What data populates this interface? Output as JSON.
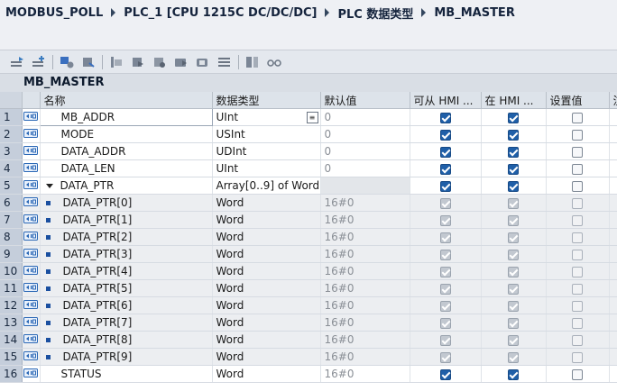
{
  "breadcrumb": [
    "MODBUS_POLL",
    "PLC_1 [CPU 1215C DC/DC/DC]",
    "PLC 数据类型",
    "MB_MASTER"
  ],
  "block_title": "MB_MASTER",
  "columns": [
    "名称",
    "数据类型",
    "默认值",
    "可从 HMI ...",
    "在 HMI ...",
    "设置值",
    "注"
  ],
  "rows": [
    {
      "num": "1",
      "name": "MB_ADDR",
      "type": "UInt",
      "default": "0",
      "hmi_access": true,
      "hmi_visible": true,
      "setpoint": false,
      "kind": "top",
      "selected": true
    },
    {
      "num": "2",
      "name": "MODE",
      "type": "USInt",
      "default": "0",
      "hmi_access": true,
      "hmi_visible": true,
      "setpoint": false,
      "kind": "top"
    },
    {
      "num": "3",
      "name": "DATA_ADDR",
      "type": "UDInt",
      "default": "0",
      "hmi_access": true,
      "hmi_visible": true,
      "setpoint": false,
      "kind": "top"
    },
    {
      "num": "4",
      "name": "DATA_LEN",
      "type": "UInt",
      "default": "0",
      "hmi_access": true,
      "hmi_visible": true,
      "setpoint": false,
      "kind": "top"
    },
    {
      "num": "5",
      "name": "DATA_PTR",
      "type": "Array[0..9] of Word",
      "default": "",
      "hmi_access": true,
      "hmi_visible": true,
      "setpoint": false,
      "kind": "array"
    },
    {
      "num": "6",
      "name": "DATA_PTR[0]",
      "type": "Word",
      "default": "16#0",
      "hmi_access": true,
      "hmi_visible": true,
      "setpoint": false,
      "kind": "child"
    },
    {
      "num": "7",
      "name": "DATA_PTR[1]",
      "type": "Word",
      "default": "16#0",
      "hmi_access": true,
      "hmi_visible": true,
      "setpoint": false,
      "kind": "child"
    },
    {
      "num": "8",
      "name": "DATA_PTR[2]",
      "type": "Word",
      "default": "16#0",
      "hmi_access": true,
      "hmi_visible": true,
      "setpoint": false,
      "kind": "child"
    },
    {
      "num": "9",
      "name": "DATA_PTR[3]",
      "type": "Word",
      "default": "16#0",
      "hmi_access": true,
      "hmi_visible": true,
      "setpoint": false,
      "kind": "child"
    },
    {
      "num": "10",
      "name": "DATA_PTR[4]",
      "type": "Word",
      "default": "16#0",
      "hmi_access": true,
      "hmi_visible": true,
      "setpoint": false,
      "kind": "child"
    },
    {
      "num": "11",
      "name": "DATA_PTR[5]",
      "type": "Word",
      "default": "16#0",
      "hmi_access": true,
      "hmi_visible": true,
      "setpoint": false,
      "kind": "child"
    },
    {
      "num": "12",
      "name": "DATA_PTR[6]",
      "type": "Word",
      "default": "16#0",
      "hmi_access": true,
      "hmi_visible": true,
      "setpoint": false,
      "kind": "child"
    },
    {
      "num": "13",
      "name": "DATA_PTR[7]",
      "type": "Word",
      "default": "16#0",
      "hmi_access": true,
      "hmi_visible": true,
      "setpoint": false,
      "kind": "child"
    },
    {
      "num": "14",
      "name": "DATA_PTR[8]",
      "type": "Word",
      "default": "16#0",
      "hmi_access": true,
      "hmi_visible": true,
      "setpoint": false,
      "kind": "child"
    },
    {
      "num": "15",
      "name": "DATA_PTR[9]",
      "type": "Word",
      "default": "16#0",
      "hmi_access": true,
      "hmi_visible": true,
      "setpoint": false,
      "kind": "child"
    },
    {
      "num": "16",
      "name": "STATUS",
      "type": "Word",
      "default": "16#0",
      "hmi_access": true,
      "hmi_visible": true,
      "setpoint": false,
      "kind": "top"
    }
  ],
  "toolbar": {
    "icons": [
      "insert-row-icon",
      "add-row-icon",
      "plc-tag-icon",
      "update-icon",
      "monitor-icon",
      "go-online-icon",
      "go-offline-icon",
      "download-icon",
      "snapshot-icon",
      "list-icon",
      "expand-all-icon",
      "glasses-icon"
    ]
  },
  "colors": {
    "accent": "#1f5fa8",
    "header_bg": "#dde3ea",
    "row_number_bg": "#c5cedb"
  }
}
